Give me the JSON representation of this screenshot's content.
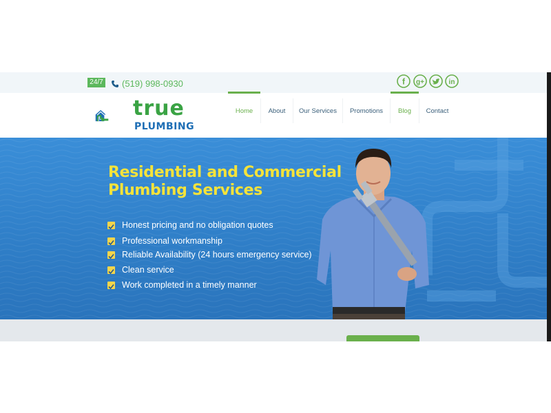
{
  "topbar": {
    "badge": "24/7",
    "phone": "(519) 998-0930",
    "social": [
      "facebook-icon",
      "google-plus-icon",
      "twitter-icon",
      "linkedin-icon"
    ]
  },
  "logo": {
    "word1": "true",
    "word2": "PLUMBING"
  },
  "nav": {
    "items": [
      "Home",
      "About",
      "Our Services",
      "Promotions",
      "Blog",
      "Contact"
    ]
  },
  "hero": {
    "title_line1": "Residential and Commercial",
    "title_line2": "Plumbing Services",
    "checklist": [
      "Honest pricing and no obligation quotes",
      "Professional workmanship",
      "Reliable Availability (24 hours emergency service)",
      "Clean service",
      "Work completed in a timely manner"
    ]
  },
  "colors": {
    "brand_green": "#6ab04c",
    "brand_blue": "#2f7ec7",
    "title_yellow": "#f5e33a"
  }
}
